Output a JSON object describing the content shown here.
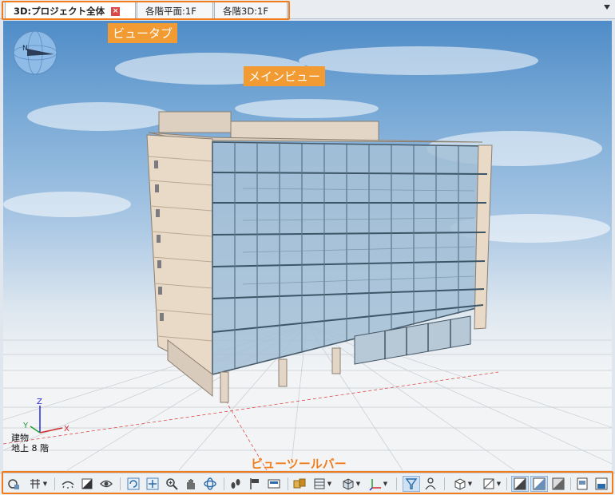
{
  "tabs": [
    {
      "label": "3D:プロジェクト全体",
      "active": true,
      "closable": true
    },
    {
      "label": "各階平面:1F",
      "active": false
    },
    {
      "label": "各階3D:1F",
      "active": false
    }
  ],
  "annotations": {
    "view_tabs": "ビュータブ",
    "main_view": "メインビュー",
    "view_toolbar": "ビューツールバー"
  },
  "axes": {
    "z": "Z",
    "y": "Y",
    "x": "X"
  },
  "building_info": {
    "line1": "建物",
    "line2": "地上 8 階"
  },
  "compass": {
    "north": "N"
  },
  "colors": {
    "highlight": "#f07c1c",
    "glass": "#8fb0cc",
    "facade": "#e6d5bf"
  },
  "toolbar_icons": [
    "orbit-settings-icon",
    "view-settings-icon",
    "hide-icon",
    "shading-icon",
    "eye-icon",
    "refresh-icon",
    "fit-view-icon",
    "zoom-icon",
    "pan-hand-icon",
    "orbit-icon",
    "walk-icon",
    "flag-icon",
    "camera-view-icon",
    "floor-plan-icon",
    "layer-icon",
    "box-view-icon",
    "axis-icon",
    "funnel-filter-icon",
    "person-icon",
    "cube-icon",
    "section-icon",
    "render-mode-1-icon",
    "render-mode-2-icon",
    "render-mode-3-icon",
    "export-image-icon",
    "save-image-icon"
  ]
}
